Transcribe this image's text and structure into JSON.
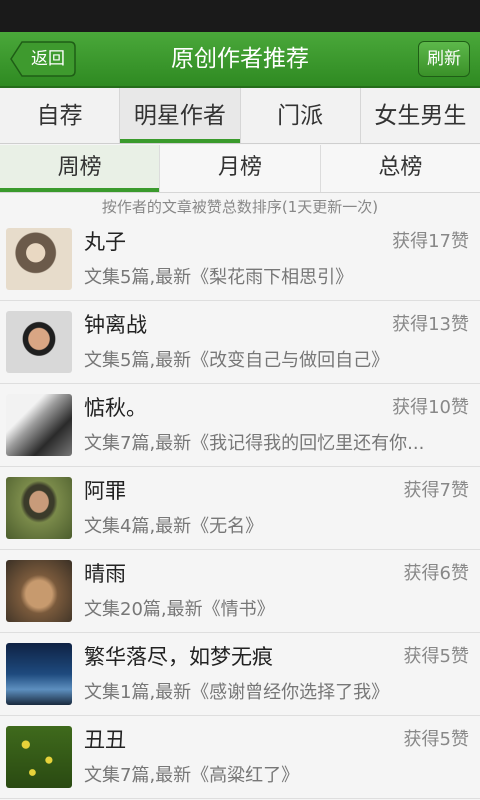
{
  "header": {
    "back_label": "返回",
    "title": "原创作者推荐",
    "refresh_label": "刷新"
  },
  "main_tabs": [
    {
      "label": "自荐",
      "active": false
    },
    {
      "label": "明星作者",
      "active": true
    },
    {
      "label": "门派",
      "active": false
    },
    {
      "label": "女生男生",
      "active": false
    }
  ],
  "rank_tabs": [
    {
      "label": "周榜",
      "active": true
    },
    {
      "label": "月榜",
      "active": false
    },
    {
      "label": "总榜",
      "active": false
    }
  ],
  "subtitle": "按作者的文章被赞总数排序(1天更新一次)",
  "authors": [
    {
      "name": "丸子",
      "likes": "获得17赞",
      "desc": "文集5篇,最新《梨花雨下相思引》"
    },
    {
      "name": "钟离战",
      "likes": "获得13赞",
      "desc": "文集5篇,最新《改变自己与做回自己》"
    },
    {
      "name": "惦秋。",
      "likes": "获得10赞",
      "desc": "文集7篇,最新《我记得我的回忆里还有你..."
    },
    {
      "name": "阿罪",
      "likes": "获得7赞",
      "desc": "文集4篇,最新《无名》"
    },
    {
      "name": "晴雨",
      "likes": "获得6赞",
      "desc": "文集20篇,最新《情书》"
    },
    {
      "name": "繁华落尽，如梦无痕",
      "likes": "获得5赞",
      "desc": "文集1篇,最新《感谢曾经你选择了我》"
    },
    {
      "name": "丑丑",
      "likes": "获得5赞",
      "desc": "文集7篇,最新《高粱红了》"
    }
  ],
  "colors": {
    "accent_green": "#3a9a2c",
    "header_green": "#2f8a22"
  }
}
